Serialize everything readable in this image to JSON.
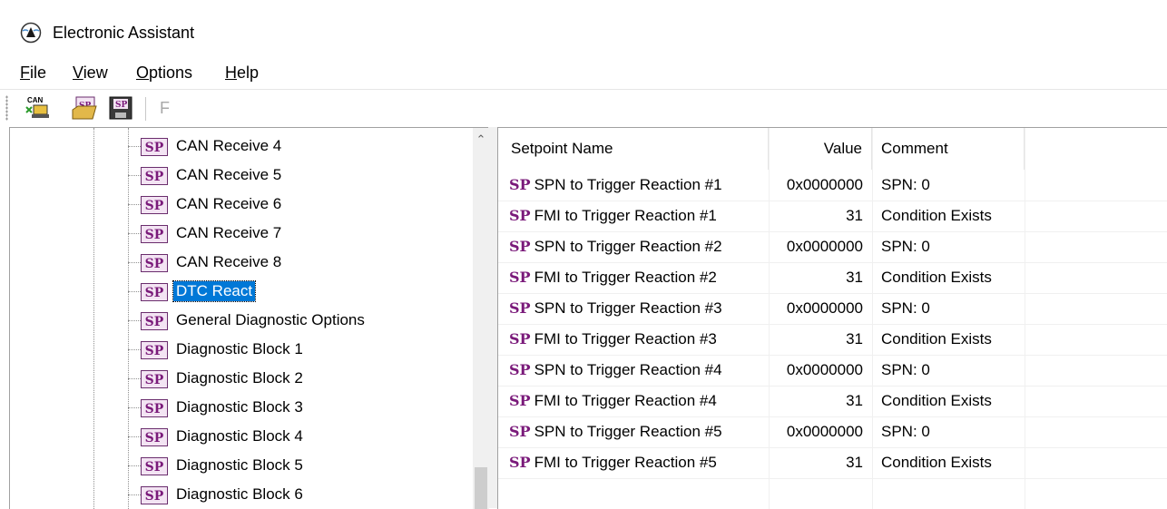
{
  "window": {
    "title": "Electronic Assistant"
  },
  "menu": [
    {
      "label": "File",
      "mnemonic": "F",
      "rest": "ile"
    },
    {
      "label": "View",
      "mnemonic": "V",
      "rest": "iew"
    },
    {
      "label": "Options",
      "mnemonic": "O",
      "rest": "ptions"
    },
    {
      "label": "Help",
      "mnemonic": "H",
      "rest": "elp"
    }
  ],
  "toolbar": {
    "connect_icon_label": "CAN",
    "open_icon_label": "SP",
    "save_icon_label": "SP",
    "flash_label": "F"
  },
  "sp_icon_text": "SP",
  "tree": {
    "items": [
      {
        "label": "CAN Receive 4"
      },
      {
        "label": "CAN Receive 5"
      },
      {
        "label": "CAN Receive 6"
      },
      {
        "label": "CAN Receive 7"
      },
      {
        "label": "CAN Receive 8"
      },
      {
        "label": "DTC React",
        "selected": true
      },
      {
        "label": "General Diagnostic Options"
      },
      {
        "label": "Diagnostic Block 1"
      },
      {
        "label": "Diagnostic Block 2"
      },
      {
        "label": "Diagnostic Block 3"
      },
      {
        "label": "Diagnostic Block 4"
      },
      {
        "label": "Diagnostic Block 5"
      },
      {
        "label": "Diagnostic Block 6"
      }
    ]
  },
  "setpoints": {
    "columns": {
      "name": "Setpoint Name",
      "value": "Value",
      "comment": "Comment"
    },
    "rows": [
      {
        "name": "SPN to Trigger Reaction #1",
        "value": "0x0000000",
        "comment": "SPN: 0"
      },
      {
        "name": "FMI to Trigger Reaction #1",
        "value": "31",
        "comment": "Condition Exists"
      },
      {
        "name": "SPN to Trigger Reaction #2",
        "value": "0x0000000",
        "comment": "SPN: 0"
      },
      {
        "name": "FMI to Trigger Reaction #2",
        "value": "31",
        "comment": "Condition Exists"
      },
      {
        "name": "SPN to Trigger Reaction #3",
        "value": "0x0000000",
        "comment": "SPN: 0"
      },
      {
        "name": "FMI to Trigger Reaction #3",
        "value": "31",
        "comment": "Condition Exists"
      },
      {
        "name": "SPN to Trigger Reaction #4",
        "value": "0x0000000",
        "comment": "SPN: 0"
      },
      {
        "name": "FMI to Trigger Reaction #4",
        "value": "31",
        "comment": "Condition Exists"
      },
      {
        "name": "SPN to Trigger Reaction #5",
        "value": "0x0000000",
        "comment": "SPN: 0"
      },
      {
        "name": "FMI to Trigger Reaction #5",
        "value": "31",
        "comment": "Condition Exists"
      }
    ]
  },
  "colors": {
    "selection": "#0078d7",
    "sp_purple": "#7a1a7a"
  }
}
